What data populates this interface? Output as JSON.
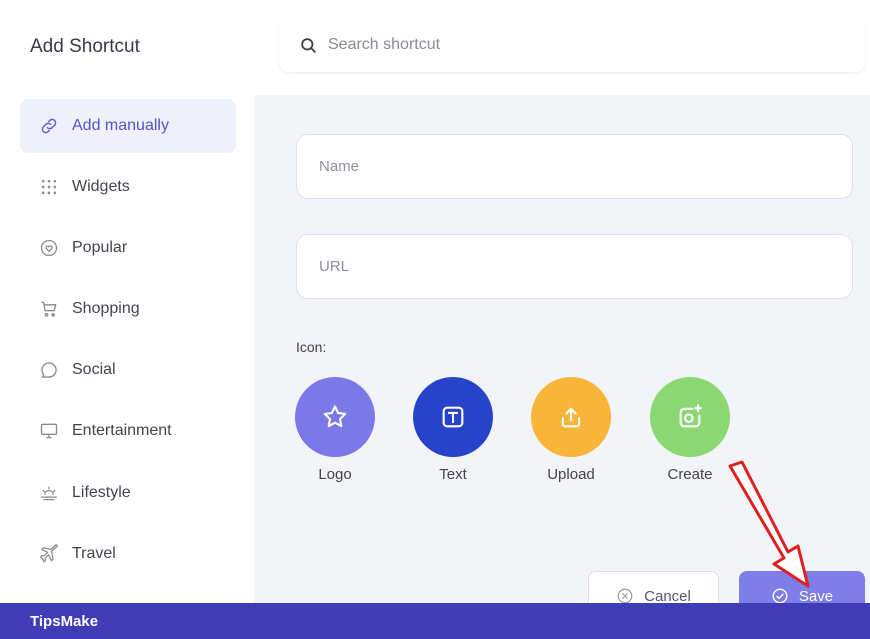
{
  "sidebar": {
    "title": "Add Shortcut",
    "items": [
      {
        "label": "Add manually"
      },
      {
        "label": "Widgets"
      },
      {
        "label": "Popular"
      },
      {
        "label": "Shopping"
      },
      {
        "label": "Social"
      },
      {
        "label": "Entertainment"
      },
      {
        "label": "Lifestyle"
      },
      {
        "label": "Travel"
      }
    ]
  },
  "search": {
    "placeholder": "Search shortcut",
    "icon": "search-icon"
  },
  "form": {
    "name_placeholder": "Name",
    "url_placeholder": "URL",
    "icon_label": "Icon:",
    "icon_options": [
      {
        "label": "Logo",
        "icon": "star-icon",
        "color": "#7b78e8"
      },
      {
        "label": "Text",
        "icon": "text-t-icon",
        "color": "#2743c9"
      },
      {
        "label": "Upload",
        "icon": "upload-icon",
        "color": "#f9b43a"
      },
      {
        "label": "Create",
        "icon": "camera-plus-icon",
        "color": "#8bd873"
      }
    ]
  },
  "actions": {
    "cancel_label": "Cancel",
    "save_label": "Save"
  },
  "footer": {
    "brand": "TipsMake"
  },
  "colors": {
    "accent": "#7f7de8",
    "footer": "#3f3cb5",
    "annotation_arrow": "#e02020"
  }
}
